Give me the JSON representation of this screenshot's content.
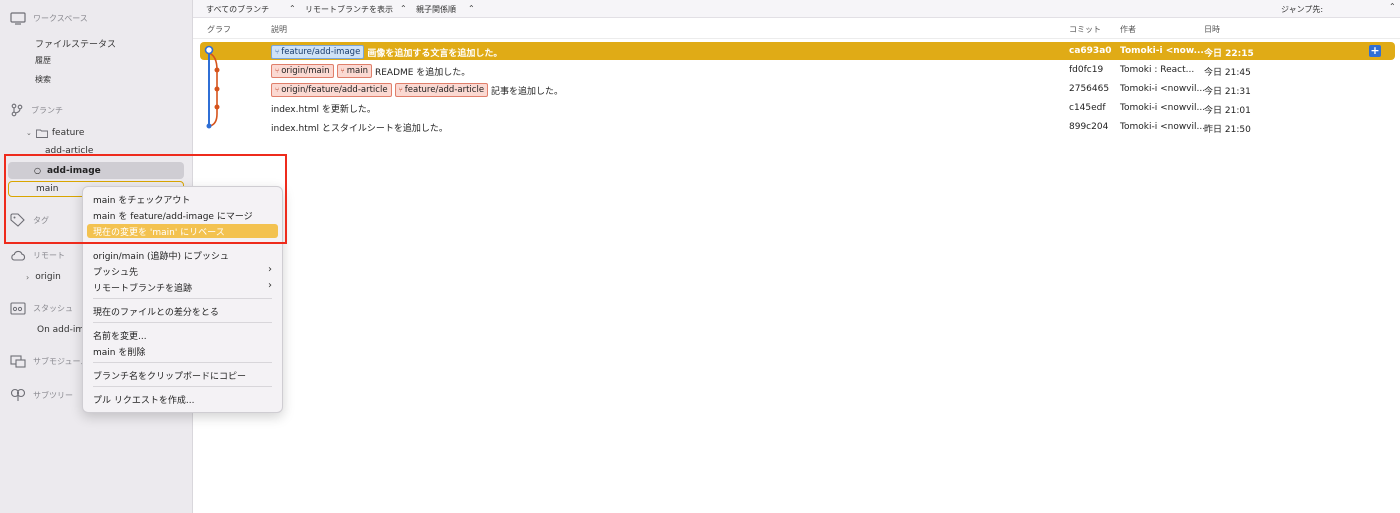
{
  "sidebar": {
    "workspace": "ワークスペース",
    "file_status": "ファイルステータス",
    "history": "履歴",
    "search": "検索",
    "branches": "ブランチ",
    "folder_feature": "feature",
    "branch_add_article": "add-article",
    "branch_add_image": "add-image",
    "branch_main": "main",
    "tags": "タグ",
    "remotes": "リモート",
    "remote_origin": "origin",
    "stash": "スタッシュ",
    "stash_item": "On add-im",
    "submodules": "サブモジュール",
    "subtrees": "サブツリー"
  },
  "topbar": {
    "branches_select": "すべてのブランチ",
    "remote_toggle": "リモートブランチを表示",
    "sort_select": "親子関係順",
    "jump": "ジャンプ先:"
  },
  "columns": {
    "graph": "グラフ",
    "description": "説明",
    "commit": "コミット",
    "author": "作者",
    "date": "日時"
  },
  "commits": [
    {
      "tags": [
        "feature/add-image"
      ],
      "message": "画像を追加する文言を追加した。",
      "hash": "ca693a0",
      "author": "Tomoki-i <now...",
      "date": "今日 22:15"
    },
    {
      "tags": [
        "origin/main",
        "main"
      ],
      "message": "README を追加した。",
      "hash": "fd0fc19",
      "author": "Tomoki : React...",
      "date": "今日 21:45"
    },
    {
      "tags": [
        "origin/feature/add-article",
        "feature/add-article"
      ],
      "message": "記事を追加した。",
      "hash": "2756465",
      "author": "Tomoki-i <nowvil...",
      "date": "今日 21:31"
    },
    {
      "tags": [],
      "message": "index.html を更新した。",
      "hash": "c145edf",
      "author": "Tomoki-i <nowvil...",
      "date": "今日 21:01"
    },
    {
      "tags": [],
      "message": "index.html とスタイルシートを追加した。",
      "hash": "899c204",
      "author": "Tomoki-i <nowvil...",
      "date": "昨日 21:50"
    }
  ],
  "menu": {
    "checkout": "main をチェックアウト",
    "merge": "main を feature/add-image にマージ",
    "rebase": "現在の変更を 'main' にリベース",
    "push": "origin/main (追跡中) にプッシュ",
    "push_to": "プッシュ先",
    "track_remote": "リモートブランチを追跡",
    "diff": "現在のファイルとの差分をとる",
    "rename": "名前を変更...",
    "delete": "main を削除",
    "copy_name": "ブランチ名をクリップボードにコピー",
    "pull_request": "プル リクエストを作成..."
  },
  "colors": {
    "selected_row": "#e0ab16",
    "menu_highlight": "#f3c250",
    "annotation": "#ee2b1c",
    "graph_blue": "#2f6fd6",
    "graph_orange": "#d6531b"
  }
}
